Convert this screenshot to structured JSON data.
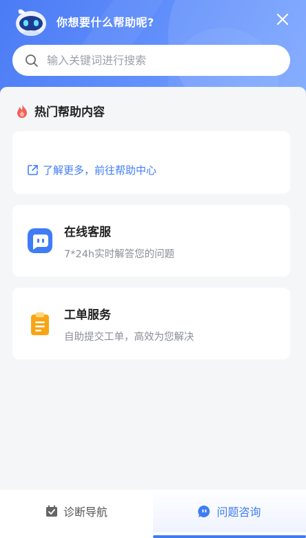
{
  "header": {
    "title": "你想要什么帮助呢?",
    "avatar_icon": "robot-avatar-icon",
    "close_icon": "close-icon"
  },
  "search": {
    "placeholder": "输入关键词进行搜索",
    "value": "",
    "icon": "search-icon"
  },
  "hot_help": {
    "title": "热门帮助内容",
    "icon": "fire-icon",
    "more_link": "了解更多，前往帮助中心",
    "more_icon": "external-link-icon"
  },
  "services": [
    {
      "title": "在线客服",
      "desc": "7*24h实时解答您的问题",
      "icon": "chat-bubble-icon",
      "color": "#3f7cf5"
    },
    {
      "title": "工单服务",
      "desc": "自助提交工单，高效为您解决",
      "icon": "clipboard-icon",
      "color": "#f7a516"
    }
  ],
  "tabs": [
    {
      "label": "诊断导航",
      "icon": "calendar-check-icon",
      "active": false
    },
    {
      "label": "问题咨询",
      "icon": "chat-bubble-icon",
      "active": true
    }
  ],
  "colors": {
    "accent": "#3f7cf5",
    "header_start": "#4b7bf5",
    "header_end": "#7aa6ff",
    "fire": "#f25f5c",
    "clipboard": "#f7a516"
  }
}
